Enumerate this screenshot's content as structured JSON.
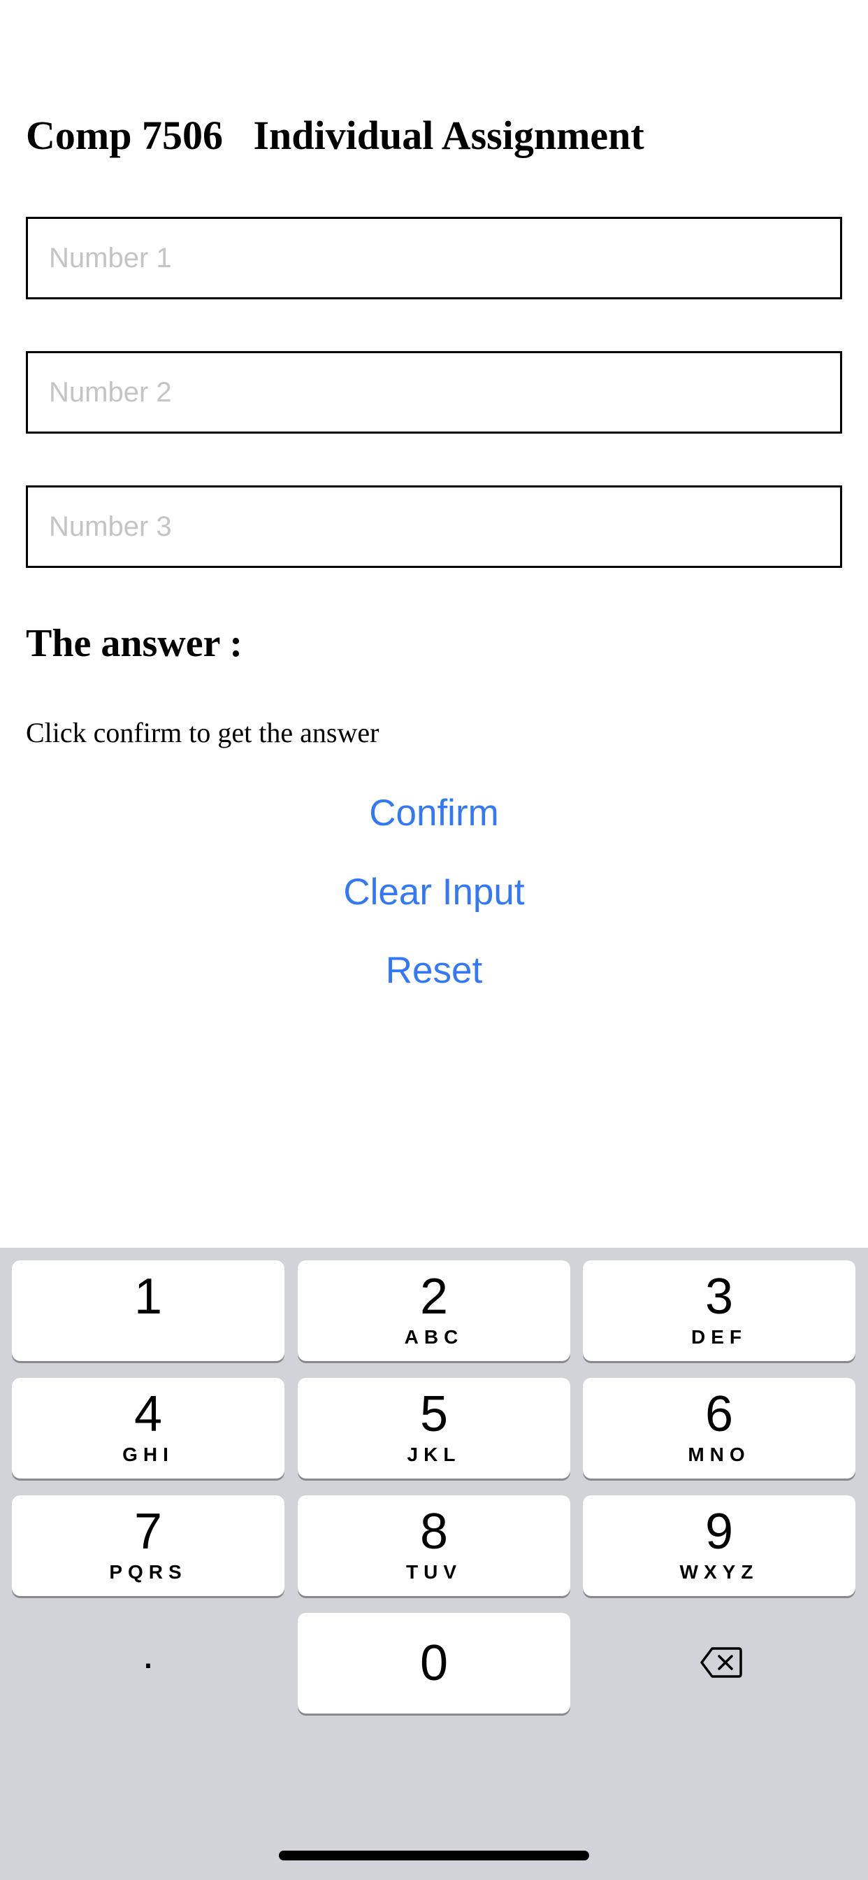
{
  "header": {
    "title": "Comp 7506   Individual Assignment"
  },
  "form": {
    "number1_placeholder": "Number 1",
    "number1_value": "",
    "number2_placeholder": "Number 2",
    "number2_value": "",
    "number3_placeholder": "Number 3",
    "number3_value": ""
  },
  "answer": {
    "heading": "The answer :",
    "text": "Click confirm to get the answer"
  },
  "actions": {
    "confirm_label": "Confirm",
    "clear_label": "Clear Input",
    "reset_label": "Reset"
  },
  "keyboard": {
    "keys": [
      {
        "digit": "1",
        "letters": ""
      },
      {
        "digit": "2",
        "letters": "ABC"
      },
      {
        "digit": "3",
        "letters": "DEF"
      },
      {
        "digit": "4",
        "letters": "GHI"
      },
      {
        "digit": "5",
        "letters": "JKL"
      },
      {
        "digit": "6",
        "letters": "MNO"
      },
      {
        "digit": "7",
        "letters": "PQRS"
      },
      {
        "digit": "8",
        "letters": "TUV"
      },
      {
        "digit": "9",
        "letters": "WXYZ"
      }
    ],
    "zero": "0",
    "dot": ".",
    "delete_icon": "backspace-icon"
  },
  "colors": {
    "link": "#3478f6",
    "keyboard_bg": "#d1d3d9",
    "key_bg": "#ffffff"
  }
}
